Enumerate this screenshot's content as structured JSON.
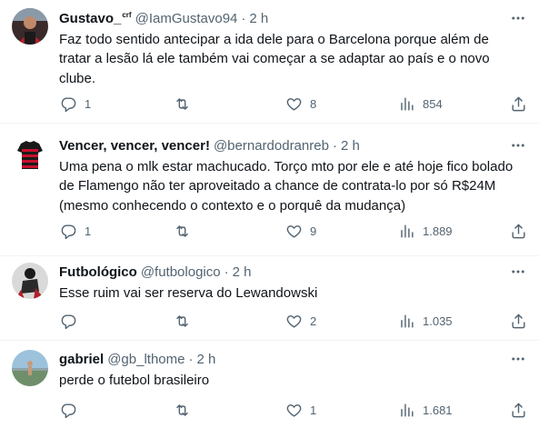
{
  "tweets": [
    {
      "name": "Gustavo_",
      "name_suffix": "crf",
      "handle": "@IamGustavo94",
      "time": "2 h",
      "text": "Faz todo sentido antecipar a ida dele para o Barcelona porque além de tratar a lesão lá ele também vai começar a se adaptar ao país e o novo clube.",
      "replies": "1",
      "retweets": "",
      "likes": "8",
      "views": "854"
    },
    {
      "name": "Vencer, vencer, vencer!",
      "handle": "@bernardodranreb",
      "time": "2 h",
      "text": "Uma pena o mlk estar machucado. Torço mto por ele e até hoje fico bolado de Flamengo não ter aproveitado a chance de contrata-lo por só R$24M (mesmo conhecendo o contexto e o porquê da mudança)",
      "replies": "1",
      "retweets": "",
      "likes": "9",
      "views": "1.889"
    },
    {
      "name": "Futbológico",
      "handle": "@futbologico",
      "time": "2 h",
      "text": "Esse ruim vai ser reserva do Lewandowski",
      "replies": "",
      "retweets": "",
      "likes": "2",
      "views": "1.035"
    },
    {
      "name": "gabriel",
      "handle": "@gb_lthome",
      "time": "2 h",
      "text": "perde o futebol brasileiro",
      "replies": "",
      "retweets": "",
      "likes": "1",
      "views": "1.681"
    }
  ],
  "separator": "·",
  "icons": {
    "more": "more-icon",
    "reply": "reply-icon",
    "retweet": "retweet-icon",
    "like": "heart-icon",
    "views": "views-icon",
    "share": "share-icon"
  },
  "colors": {
    "text": "#0f1419",
    "secondary": "#536471",
    "border": "#eff3f4"
  }
}
